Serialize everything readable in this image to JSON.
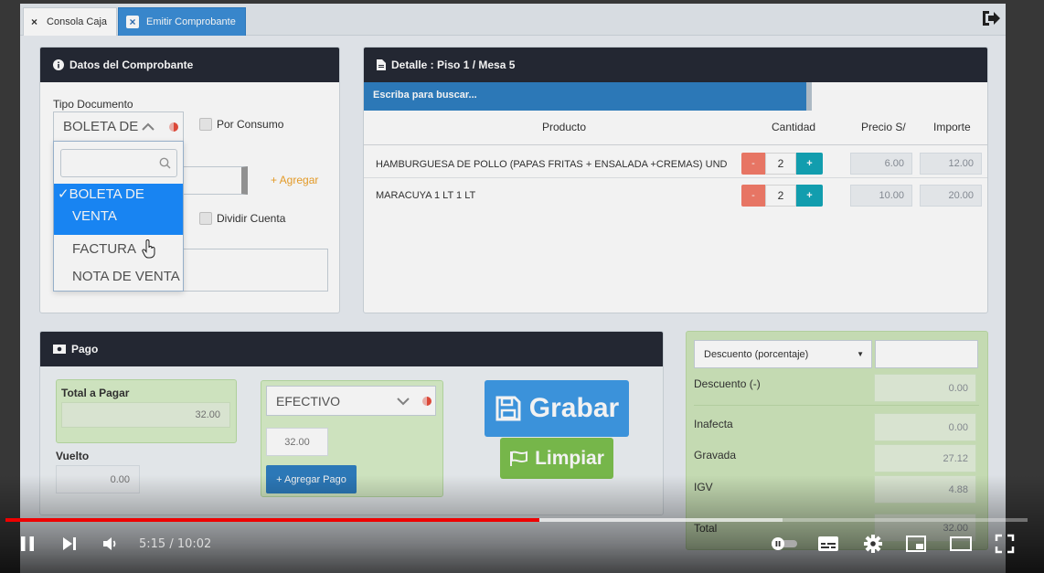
{
  "tabs": [
    {
      "label": "Consola Caja",
      "active": false
    },
    {
      "label": "Emitir Comprobante",
      "active": true
    }
  ],
  "datos": {
    "title": "Datos del Comprobante",
    "tipo_documento_label": "Tipo Documento",
    "tipo_documento_value": "BOLETA DE",
    "por_consumo_label": "Por Consumo",
    "agregar_label": "+ Agregar",
    "dividir_cuenta_label": "Dividir Cuenta",
    "dropdown_options": [
      {
        "label": "✓BOLETA DE",
        "label2": "VENTA",
        "selected": true
      },
      {
        "label": "FACTURA",
        "selected": false
      },
      {
        "label": "NOTA DE VENTA",
        "selected": false
      }
    ]
  },
  "detalle": {
    "title": "Detalle : Piso 1 / Mesa 5",
    "search_placeholder": "Escriba para buscar...",
    "columns": {
      "producto": "Producto",
      "cantidad": "Cantidad",
      "precio": "Precio S/",
      "importe": "Importe"
    },
    "rows": [
      {
        "producto": "HAMBURGUESA DE POLLO (PAPAS FRITAS + ENSALADA +CREMAS) UND",
        "minus": "-",
        "cantidad": "2",
        "plus": "+",
        "precio": "6.00",
        "importe": "12.00"
      },
      {
        "producto": "MARACUYA 1 LT 1 LT",
        "minus": "-",
        "cantidad": "2",
        "plus": "+",
        "precio": "10.00",
        "importe": "20.00"
      }
    ]
  },
  "pago": {
    "title": "Pago",
    "total_label": "Total a Pagar",
    "total_value": "32.00",
    "vuelto_label": "Vuelto",
    "vuelto_value": "0.00",
    "metodo_value": "EFECTIVO",
    "monto_value": "32.00",
    "agregar_pago_label": "+ Agregar Pago",
    "grabar_label": "Grabar",
    "limpiar_label": "Limpiar"
  },
  "totales": {
    "descuento_tipo": "Descuento (porcentaje)",
    "descuento_input": "",
    "rows": [
      {
        "label": "Descuento (-)",
        "value": "0.00"
      },
      {
        "label": "Inafecta",
        "value": "0.00"
      },
      {
        "label": "Gravada",
        "value": "27.12"
      },
      {
        "label": "IGV",
        "value": "4.88"
      },
      {
        "label": "Total",
        "value": "32.00"
      }
    ]
  },
  "player": {
    "time": "5:15 / 10:02",
    "progress_played": 0.522,
    "progress_buffered": 0.76
  },
  "colors": {
    "header_dark": "#252a35",
    "accent_blue": "#2f7fc1",
    "green": "#7dc04e",
    "minus_red": "#f47c6a",
    "plus_teal": "#13a6b8",
    "progress_red": "#e00000"
  }
}
